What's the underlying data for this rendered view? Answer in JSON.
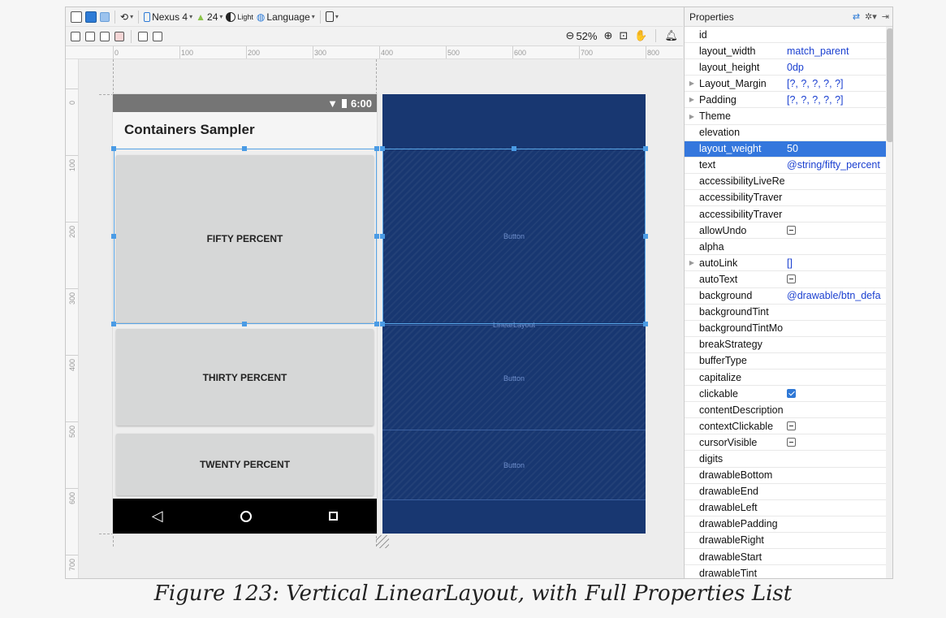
{
  "toolbar": {
    "device": "Nexus 4",
    "api": "24",
    "theme": "Light",
    "language": "Language",
    "zoom": "52%"
  },
  "ruler": {
    "h_ticks": [
      "0",
      "100",
      "200",
      "300",
      "400",
      "500",
      "600",
      "700",
      "800"
    ],
    "v_ticks": [
      "0",
      "100",
      "200",
      "300",
      "400",
      "500",
      "600",
      "700"
    ]
  },
  "phone": {
    "time": "6:00",
    "app_title": "Containers Sampler",
    "buttons": [
      "FIFTY PERCENT",
      "THIRTY PERCENT",
      "TWENTY PERCENT"
    ]
  },
  "blueprint": {
    "button_labels": [
      "Button",
      "Button",
      "Button"
    ],
    "layout_label": "LinearLayout"
  },
  "properties": {
    "title": "Properties",
    "selected_index": 7,
    "rows": [
      {
        "name": "id",
        "value": ""
      },
      {
        "name": "layout_width",
        "value": "match_parent"
      },
      {
        "name": "layout_height",
        "value": "0dp"
      },
      {
        "name": "Layout_Margin",
        "value": "[?, ?, ?, ?, ?]",
        "expandable": true
      },
      {
        "name": "Padding",
        "value": "[?, ?, ?, ?, ?]",
        "expandable": true
      },
      {
        "name": "Theme",
        "value": "",
        "expandable": true
      },
      {
        "name": "elevation",
        "value": ""
      },
      {
        "name": "layout_weight",
        "value": "50"
      },
      {
        "name": "text",
        "value": "@string/fifty_percent"
      },
      {
        "name": "accessibilityLiveRe",
        "value": ""
      },
      {
        "name": "accessibilityTraver",
        "value": ""
      },
      {
        "name": "accessibilityTraver",
        "value": ""
      },
      {
        "name": "allowUndo",
        "value": "",
        "check": "dash"
      },
      {
        "name": "alpha",
        "value": ""
      },
      {
        "name": "autoLink",
        "value": "[]",
        "expandable": true
      },
      {
        "name": "autoText",
        "value": "",
        "check": "dash"
      },
      {
        "name": "background",
        "value": "@drawable/btn_defa"
      },
      {
        "name": "backgroundTint",
        "value": ""
      },
      {
        "name": "backgroundTintMo",
        "value": ""
      },
      {
        "name": "breakStrategy",
        "value": ""
      },
      {
        "name": "bufferType",
        "value": ""
      },
      {
        "name": "capitalize",
        "value": ""
      },
      {
        "name": "clickable",
        "value": "",
        "check": "on"
      },
      {
        "name": "contentDescription",
        "value": ""
      },
      {
        "name": "contextClickable",
        "value": "",
        "check": "dash"
      },
      {
        "name": "cursorVisible",
        "value": "",
        "check": "dash"
      },
      {
        "name": "digits",
        "value": ""
      },
      {
        "name": "drawableBottom",
        "value": ""
      },
      {
        "name": "drawableEnd",
        "value": ""
      },
      {
        "name": "drawableLeft",
        "value": ""
      },
      {
        "name": "drawablePadding",
        "value": ""
      },
      {
        "name": "drawableRight",
        "value": ""
      },
      {
        "name": "drawableStart",
        "value": ""
      },
      {
        "name": "drawableTint",
        "value": ""
      }
    ]
  },
  "caption": "Figure 123: Vertical LinearLayout, with Full Properties List"
}
